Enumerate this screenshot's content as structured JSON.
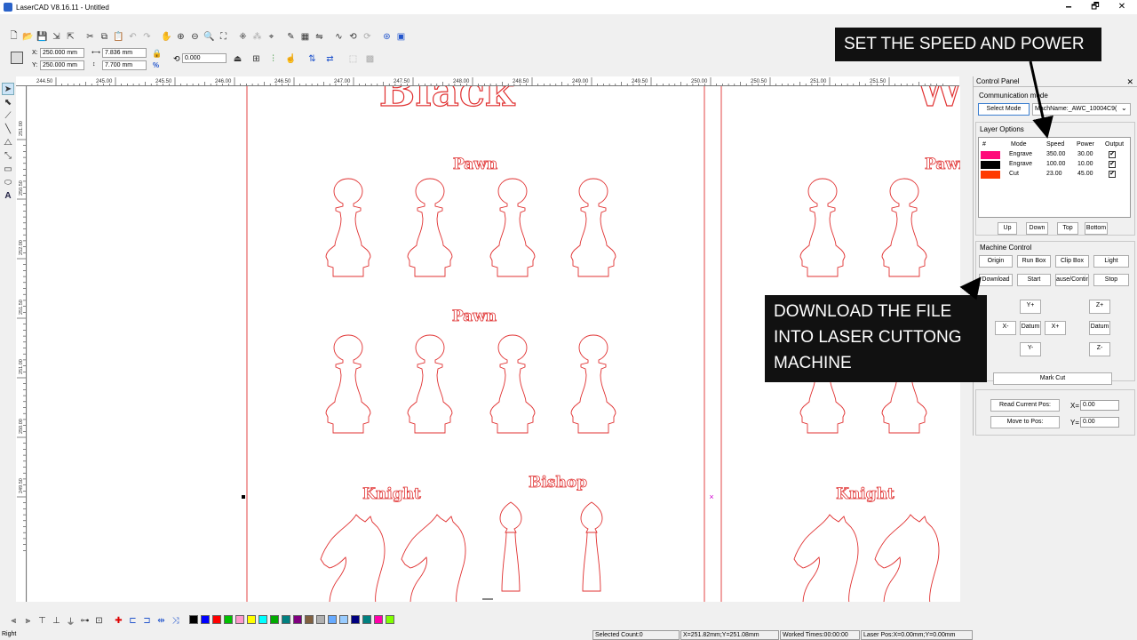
{
  "window": {
    "title": "LaserCAD V8.16.11 - Untitled",
    "minimize": "🗕",
    "restore": "🗗",
    "close": "✕"
  },
  "toolbar_top": {
    "icons": [
      "new-file-icon",
      "open-file-icon",
      "save-icon",
      "import-icon",
      "export-icon",
      "cut-icon",
      "copy-icon",
      "paste-icon",
      "undo-icon",
      "redo-icon",
      "pan-hand-icon",
      "zoom-in-icon",
      "zoom-out-icon",
      "zoom-window-icon",
      "zoom-fit-icon",
      "select-nodes-icon",
      "break-icon",
      "node-edit-icon",
      "bezier-icon",
      "array-icon",
      "mirror-icon",
      "smooth-icon",
      "close-path-icon",
      "rotate-icon",
      "globe-icon",
      "preview-icon"
    ]
  },
  "position": {
    "x_label": "X:",
    "x_value": "250.000 mm",
    "y_label": "Y:",
    "y_value": "250.000 mm",
    "w_value": "7.836 mm",
    "h_value": "7.700 mm",
    "angle": "0.000",
    "lock_ratio_symbol": "%"
  },
  "ruler_top_labels": [
    "244.50",
    "245.00",
    "245.50",
    "246.00",
    "246.50",
    "247.00",
    "247.50",
    "248.00",
    "248.50",
    "249.00",
    "249.50",
    "250.00",
    "250.50",
    "251.00",
    "251.50"
  ],
  "ruler_left_labels": [
    "251.00",
    "250.50",
    "252.00",
    "251.50",
    "251.00",
    "250.00",
    "249.50"
  ],
  "canvas": {
    "headings": [
      "Black",
      "Wh"
    ],
    "labels": [
      {
        "text": "Pawn"
      },
      {
        "text": "Pawn"
      },
      {
        "text": "Pawn"
      },
      {
        "text": "Knight"
      },
      {
        "text": "Bishop"
      },
      {
        "text": "Knight"
      }
    ]
  },
  "control_panel": {
    "title": "Control Panel",
    "comm_label": "Communication mode",
    "select_mode": "Select Mode",
    "mach_name": "MachName:_AWC_10004C9(",
    "layer_options_label": "Layer Options",
    "columns": [
      "#",
      "Mode",
      "Speed",
      "Power",
      "Output"
    ],
    "layers": [
      {
        "color": "#ff0a7a",
        "mode": "Engrave",
        "speed": "350.00",
        "power": "30.00",
        "output": "✔"
      },
      {
        "color": "#000000",
        "mode": "Engrave",
        "speed": "100.00",
        "power": "10.00",
        "output": "✔"
      },
      {
        "color": "#ff3a00",
        "mode": "Cut",
        "speed": "23.00",
        "power": "45.00",
        "output": "✔"
      }
    ],
    "layer_buttons": [
      "Up",
      "Down",
      "Top",
      "Bottom"
    ],
    "machine_control_label": "Machine Control",
    "machine_buttons": [
      "Origin",
      "Run Box",
      "Clip Box",
      "Light",
      "Download",
      "Start",
      "ause/Continu",
      "Stop"
    ],
    "jog": {
      "y_plus": "Y+",
      "y_minus": "Y-",
      "x_minus": "X-",
      "x_plus": "X+",
      "datum": "Datum",
      "z_plus": "Z+",
      "z_minus": "Z-",
      "z_datum": "Datum"
    },
    "mark_cut": "Mark Cut",
    "read_pos": "Read Current Pos:",
    "move_pos": "Move to Pos:",
    "x_label": "X=",
    "x_value": "0.00",
    "y_label": "Y=",
    "y_value": "0.00"
  },
  "callouts": {
    "speed_power": "SET THE SPEED AND POWER",
    "download_line1": "DOWNLOAD THE FILE",
    "download_line2": "INTO LASER CUTTONG",
    "download_line3": "MACHINE"
  },
  "palette": [
    "#000000",
    "#0000ff",
    "#ff0000",
    "#00c000",
    "#ff99cc",
    "#ffff00",
    "#00ffff",
    "#00aa00",
    "#008080",
    "#800080",
    "#806040",
    "#b0b0b0",
    "#66aaff",
    "#99ccff",
    "#000080",
    "#008080",
    "#ff00aa",
    "#80ff00"
  ],
  "status": {
    "left": "Right",
    "selected": "Selected Count:0",
    "coords": "X=251.82mm;Y=251.08mm",
    "worked": "Worked Times:00:00:00",
    "laser_pos": "Laser Pos:X=0.00mm;Y=0.00mm"
  }
}
